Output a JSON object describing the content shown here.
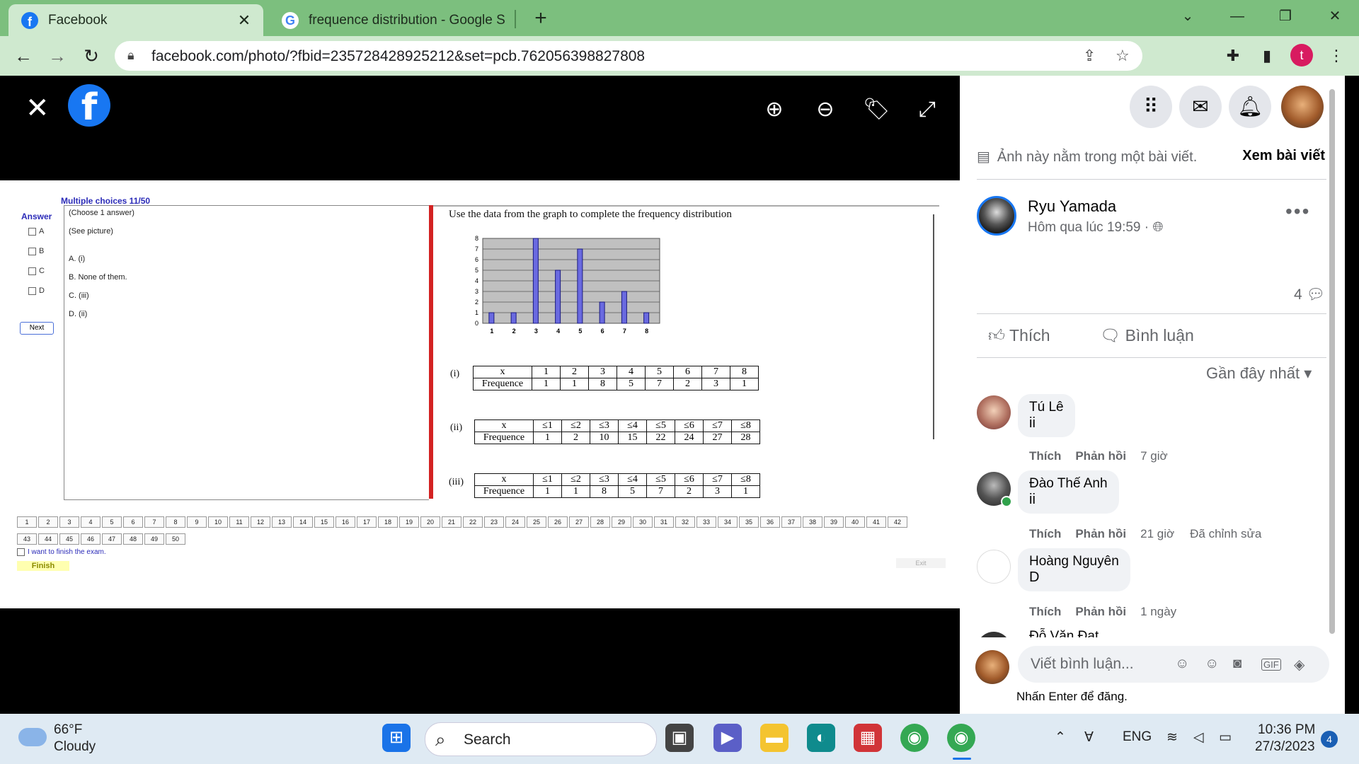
{
  "browser": {
    "tabs": [
      {
        "title": "Facebook",
        "active": true
      },
      {
        "title": "frequence distribution - Google S",
        "active": false
      }
    ],
    "url": "facebook.com/photo/?fbid=235728428925212&set=pcb.762056398827808",
    "profile_letter": "t"
  },
  "viewer": {
    "exam_title": "Multiple choices 11/50",
    "answer_label": "Answer",
    "answer_options": [
      "A",
      "B",
      "C",
      "D"
    ],
    "next_label": "Next",
    "question_lines": [
      "(Choose 1 answer)",
      "(See picture)"
    ],
    "choices": [
      "A. (i)",
      "B. None of them.",
      "C. (iii)",
      "D. (ii)"
    ],
    "prompt": "Use the data from the graph to complete the frequency distribution",
    "table_x_label": "x",
    "table_freq_label": "Frequence",
    "table_i": {
      "label": "(i)",
      "x": [
        "1",
        "2",
        "3",
        "4",
        "5",
        "6",
        "7",
        "8"
      ],
      "freq": [
        "1",
        "1",
        "8",
        "5",
        "7",
        "2",
        "3",
        "1"
      ]
    },
    "table_ii": {
      "label": "(ii)",
      "x": [
        "≤1",
        "≤2",
        "≤3",
        "≤4",
        "≤5",
        "≤6",
        "≤7",
        "≤8"
      ],
      "freq": [
        "1",
        "2",
        "10",
        "15",
        "22",
        "24",
        "27",
        "28"
      ]
    },
    "table_iii": {
      "label": "(iii)",
      "x": [
        "≤1",
        "≤2",
        "≤3",
        "≤4",
        "≤5",
        "≤6",
        "≤7",
        "≤8"
      ],
      "freq": [
        "1",
        "1",
        "8",
        "5",
        "7",
        "2",
        "3",
        "1"
      ]
    },
    "finish_check": "I want to finish the exam.",
    "finish_label": "Finish",
    "exit_label": "Exit"
  },
  "chart_data": {
    "type": "bar",
    "categories": [
      "1",
      "2",
      "3",
      "4",
      "5",
      "6",
      "7",
      "8"
    ],
    "values": [
      1,
      1,
      8,
      5,
      7,
      2,
      3,
      1
    ],
    "ylim": [
      0,
      8
    ],
    "yticks": [
      "0",
      "1",
      "2",
      "3",
      "4",
      "5",
      "6",
      "7",
      "8"
    ],
    "grid": true,
    "title": "",
    "xlabel": "",
    "ylabel": ""
  },
  "side": {
    "note": "Ảnh này nằm trong một bài viết.",
    "view_post": "Xem bài viết",
    "poster_name": "Ryu Yamada",
    "poster_time": "Hôm qua lúc 19:59 ·",
    "comment_count": "4",
    "like_label": "Thích",
    "comment_label": "Bình luận",
    "sort_label": "Gần đây nhất",
    "reply_label": "Phản hồi",
    "comments": [
      {
        "name": "Tú Lê",
        "text": "ii",
        "time": "7 giờ",
        "edited": ""
      },
      {
        "name": "Đào Thế Anh",
        "text": "ii",
        "time": "21 giờ",
        "edited": "Đã chỉnh sửa"
      },
      {
        "name": "Hoàng Nguyên",
        "text": "D",
        "time": "1 ngày",
        "edited": ""
      }
    ],
    "partial_comment_name": "Đỗ Văn Đạt",
    "write_placeholder": "Viết bình luận...",
    "enter_hint": "Nhấn Enter để đăng."
  },
  "taskbar": {
    "temp": "66°F",
    "condition": "Cloudy",
    "search": "Search",
    "lang": "ENG",
    "time": "10:36 PM",
    "date": "27/3/2023",
    "notif_count": "4"
  }
}
